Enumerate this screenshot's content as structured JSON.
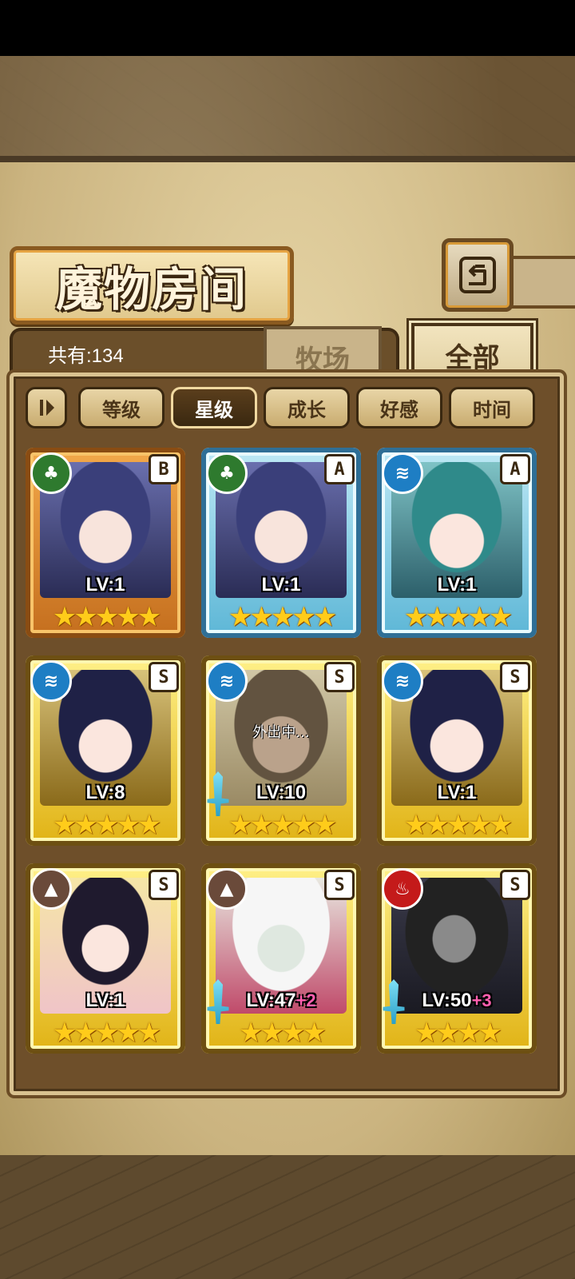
{
  "title": "魔物房间",
  "count_label": "共有:134",
  "tabs": [
    {
      "label": "牧场",
      "active": false
    },
    {
      "label": "全部",
      "active": true
    }
  ],
  "sort_buttons": [
    "等级",
    "星级",
    "成长",
    "好感",
    "时间"
  ],
  "active_sort": "星级",
  "monsters": [
    {
      "element": "grass",
      "rank": "B",
      "level": "LV:1",
      "plus": "",
      "stars": "★★★★★",
      "status": ""
    },
    {
      "element": "grass",
      "rank": "A",
      "level": "LV:1",
      "plus": "",
      "stars": "★★★★★",
      "status": ""
    },
    {
      "element": "water",
      "rank": "A",
      "level": "LV:1",
      "plus": "",
      "stars": "★★★★★",
      "status": ""
    },
    {
      "element": "water",
      "rank": "S",
      "level": "LV:8",
      "plus": "",
      "stars": "★★★★★",
      "status": ""
    },
    {
      "element": "water",
      "rank": "S",
      "level": "LV:10",
      "plus": "",
      "stars": "★★★★★",
      "status": "外出中..."
    },
    {
      "element": "water",
      "rank": "S",
      "level": "LV:1",
      "plus": "",
      "stars": "★★★★★",
      "status": ""
    },
    {
      "element": "earth",
      "rank": "S",
      "level": "LV:1",
      "plus": "",
      "stars": "★★★★★",
      "status": ""
    },
    {
      "element": "earth",
      "rank": "S",
      "level": "LV:47",
      "plus": "+2",
      "stars": "★★★★",
      "status": ""
    },
    {
      "element": "fire",
      "rank": "S",
      "level": "LV:50",
      "plus": "+3",
      "stars": "★★★★",
      "status": ""
    }
  ],
  "colors": {
    "frame_B": "#e38a2e",
    "frame_A": "#5cb6d6",
    "frame_S": "#e0b214",
    "star": "#ffcc1a",
    "plus": "#ff5fb0"
  }
}
